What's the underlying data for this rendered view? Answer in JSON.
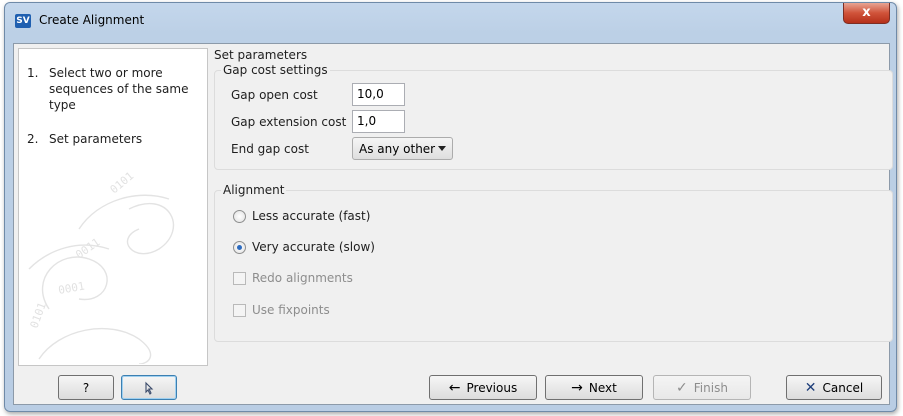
{
  "window": {
    "title": "Create Alignment",
    "app_icon_text": "SV",
    "close_symbol": "x"
  },
  "steps": [
    {
      "num": "1.",
      "label": "Select two or more sequences of the same type"
    },
    {
      "num": "2.",
      "label": "Set parameters"
    }
  ],
  "main": {
    "section_title": "Set parameters",
    "gap_cost": {
      "legend": "Gap cost settings",
      "open_label": "Gap open cost",
      "open_value": "10,0",
      "extension_label": "Gap extension cost",
      "extension_value": "1,0",
      "end_label": "End gap cost",
      "end_value": "As any other"
    },
    "alignment": {
      "legend": "Alignment",
      "less_accurate": "Less accurate (fast)",
      "very_accurate": "Very accurate (slow)",
      "selected": "very_accurate",
      "redo": "Redo alignments",
      "fixpoints": "Use fixpoints"
    }
  },
  "buttons": {
    "help": "?",
    "reset_icon": "reset-icon",
    "previous": "Previous",
    "next": "Next",
    "finish": "Finish",
    "cancel": "Cancel"
  },
  "colors": {
    "accent": "#2d6bbf",
    "cancel_x": "#1e3e7a"
  }
}
